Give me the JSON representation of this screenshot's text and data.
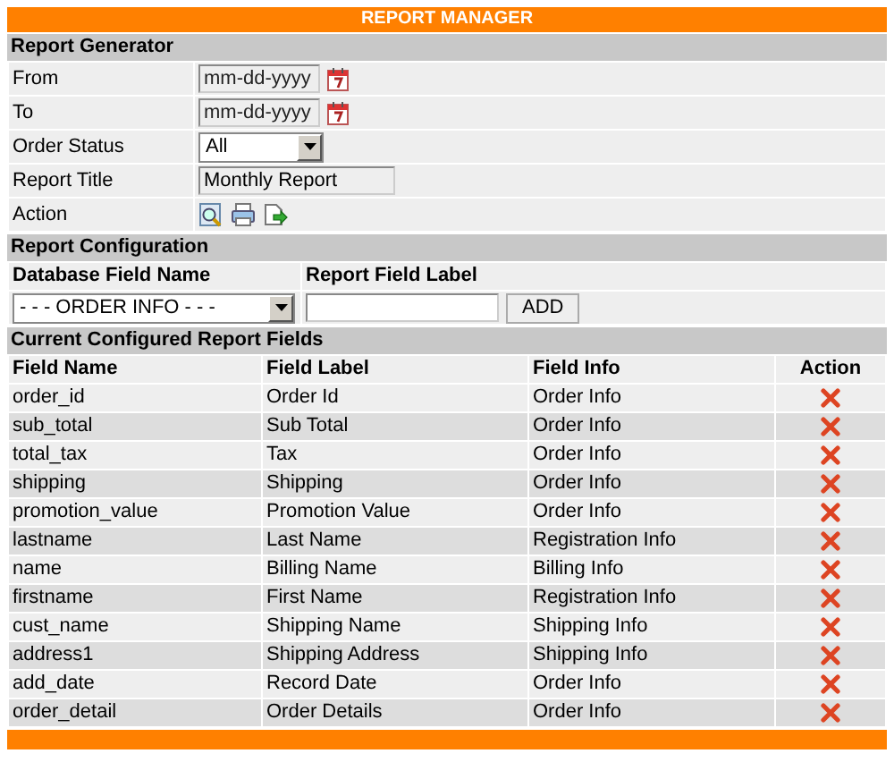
{
  "title": "REPORT MANAGER",
  "generator": {
    "title": "Report Generator",
    "fields": [
      {
        "kind": "date",
        "label": "From",
        "placeholder": "mm-dd-yyyy"
      },
      {
        "kind": "date",
        "label": "To",
        "placeholder": "mm-dd-yyyy"
      },
      {
        "kind": "select",
        "label": "Order Status",
        "value": "All"
      },
      {
        "kind": "text",
        "label": "Report Title",
        "value": "Monthly Report"
      },
      {
        "kind": "actions",
        "label": "Action"
      }
    ]
  },
  "configuration": {
    "title": "Report Configuration",
    "db_field_label": "Database Field Name",
    "report_field_label": "Report Field Label",
    "db_field_value": "- - - ORDER INFO - - -",
    "add_button": "ADD"
  },
  "fields_table": {
    "title": "Current Configured Report Fields",
    "columns": [
      "Field Name",
      "Field Label",
      "Field Info",
      "Action"
    ],
    "rows": [
      [
        "order_id",
        "Order Id",
        "Order Info"
      ],
      [
        "sub_total",
        "Sub Total",
        "Order Info"
      ],
      [
        "total_tax",
        "Tax",
        "Order Info"
      ],
      [
        "shipping",
        "Shipping",
        "Order Info"
      ],
      [
        "promotion_value",
        "Promotion Value",
        "Order Info"
      ],
      [
        "lastname",
        "Last Name",
        "Registration Info"
      ],
      [
        "name",
        "Billing Name",
        "Billing Info"
      ],
      [
        "firstname",
        "First Name",
        "Registration Info"
      ],
      [
        "cust_name",
        "Shipping Name",
        "Shipping Info"
      ],
      [
        "address1",
        "Shipping Address",
        "Shipping Info"
      ],
      [
        "add_date",
        "Record Date",
        "Order Info"
      ],
      [
        "order_detail",
        "Order Details",
        "Order Info"
      ]
    ]
  }
}
